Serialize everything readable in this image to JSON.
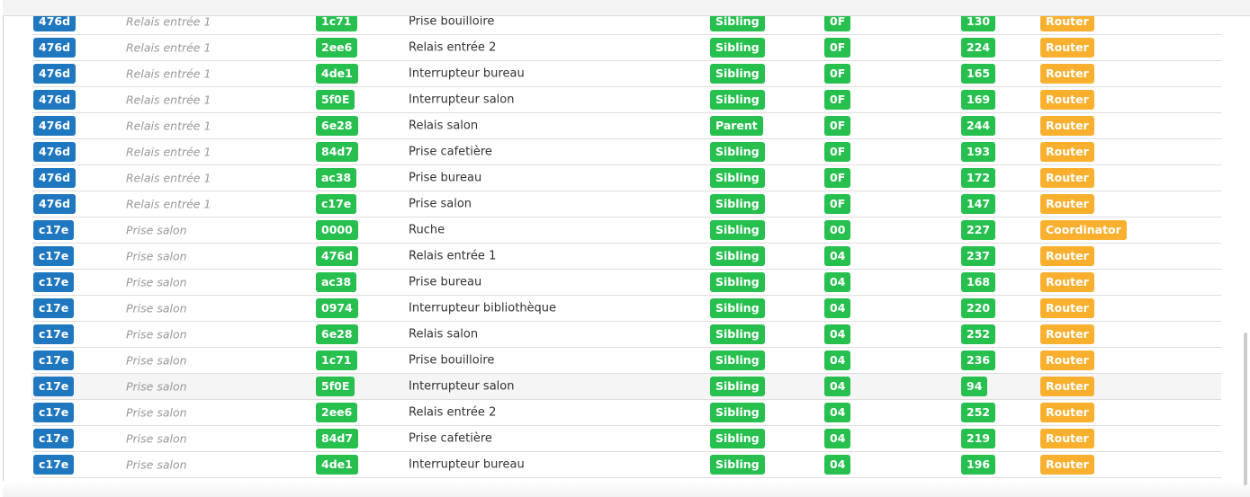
{
  "colors": {
    "source_badge": "#1f77c0",
    "neighbor_badge": "#27c04f",
    "role_badge": "#f8b02e"
  },
  "rows": [
    {
      "src": "476d",
      "src_name": "Relais entrée 1",
      "nbr": "1c71",
      "nbr_name": "Prise bouilloire",
      "rel": "Sibling",
      "depth": "0F",
      "lqi": "130",
      "type": "Router"
    },
    {
      "src": "476d",
      "src_name": "Relais entrée 1",
      "nbr": "2ee6",
      "nbr_name": "Relais entrée 2",
      "rel": "Sibling",
      "depth": "0F",
      "lqi": "224",
      "type": "Router"
    },
    {
      "src": "476d",
      "src_name": "Relais entrée 1",
      "nbr": "4de1",
      "nbr_name": "Interrupteur bureau",
      "rel": "Sibling",
      "depth": "0F",
      "lqi": "165",
      "type": "Router"
    },
    {
      "src": "476d",
      "src_name": "Relais entrée 1",
      "nbr": "5f0E",
      "nbr_name": "Interrupteur salon",
      "rel": "Sibling",
      "depth": "0F",
      "lqi": "169",
      "type": "Router"
    },
    {
      "src": "476d",
      "src_name": "Relais entrée 1",
      "nbr": "6e28",
      "nbr_name": "Relais salon",
      "rel": "Parent",
      "depth": "0F",
      "lqi": "244",
      "type": "Router"
    },
    {
      "src": "476d",
      "src_name": "Relais entrée 1",
      "nbr": "84d7",
      "nbr_name": "Prise cafetière",
      "rel": "Sibling",
      "depth": "0F",
      "lqi": "193",
      "type": "Router"
    },
    {
      "src": "476d",
      "src_name": "Relais entrée 1",
      "nbr": "ac38",
      "nbr_name": "Prise bureau",
      "rel": "Sibling",
      "depth": "0F",
      "lqi": "172",
      "type": "Router"
    },
    {
      "src": "476d",
      "src_name": "Relais entrée 1",
      "nbr": "c17e",
      "nbr_name": "Prise salon",
      "rel": "Sibling",
      "depth": "0F",
      "lqi": "147",
      "type": "Router"
    },
    {
      "src": "c17e",
      "src_name": "Prise salon",
      "nbr": "0000",
      "nbr_name": "Ruche",
      "rel": "Sibling",
      "depth": "00",
      "lqi": "227",
      "type": "Coordinator"
    },
    {
      "src": "c17e",
      "src_name": "Prise salon",
      "nbr": "476d",
      "nbr_name": "Relais entrée 1",
      "rel": "Sibling",
      "depth": "04",
      "lqi": "237",
      "type": "Router"
    },
    {
      "src": "c17e",
      "src_name": "Prise salon",
      "nbr": "ac38",
      "nbr_name": "Prise bureau",
      "rel": "Sibling",
      "depth": "04",
      "lqi": "168",
      "type": "Router"
    },
    {
      "src": "c17e",
      "src_name": "Prise salon",
      "nbr": "0974",
      "nbr_name": "Interrupteur bibliothèque",
      "rel": "Sibling",
      "depth": "04",
      "lqi": "220",
      "type": "Router"
    },
    {
      "src": "c17e",
      "src_name": "Prise salon",
      "nbr": "6e28",
      "nbr_name": "Relais salon",
      "rel": "Sibling",
      "depth": "04",
      "lqi": "252",
      "type": "Router"
    },
    {
      "src": "c17e",
      "src_name": "Prise salon",
      "nbr": "1c71",
      "nbr_name": "Prise bouilloire",
      "rel": "Sibling",
      "depth": "04",
      "lqi": "236",
      "type": "Router"
    },
    {
      "src": "c17e",
      "src_name": "Prise salon",
      "nbr": "5f0E",
      "nbr_name": "Interrupteur salon",
      "rel": "Sibling",
      "depth": "04",
      "lqi": "94",
      "type": "Router"
    },
    {
      "src": "c17e",
      "src_name": "Prise salon",
      "nbr": "2ee6",
      "nbr_name": "Relais entrée 2",
      "rel": "Sibling",
      "depth": "04",
      "lqi": "252",
      "type": "Router"
    },
    {
      "src": "c17e",
      "src_name": "Prise salon",
      "nbr": "84d7",
      "nbr_name": "Prise cafetière",
      "rel": "Sibling",
      "depth": "04",
      "lqi": "219",
      "type": "Router"
    },
    {
      "src": "c17e",
      "src_name": "Prise salon",
      "nbr": "4de1",
      "nbr_name": "Interrupteur bureau",
      "rel": "Sibling",
      "depth": "04",
      "lqi": "196",
      "type": "Router"
    }
  ],
  "highlighted_row": 14
}
